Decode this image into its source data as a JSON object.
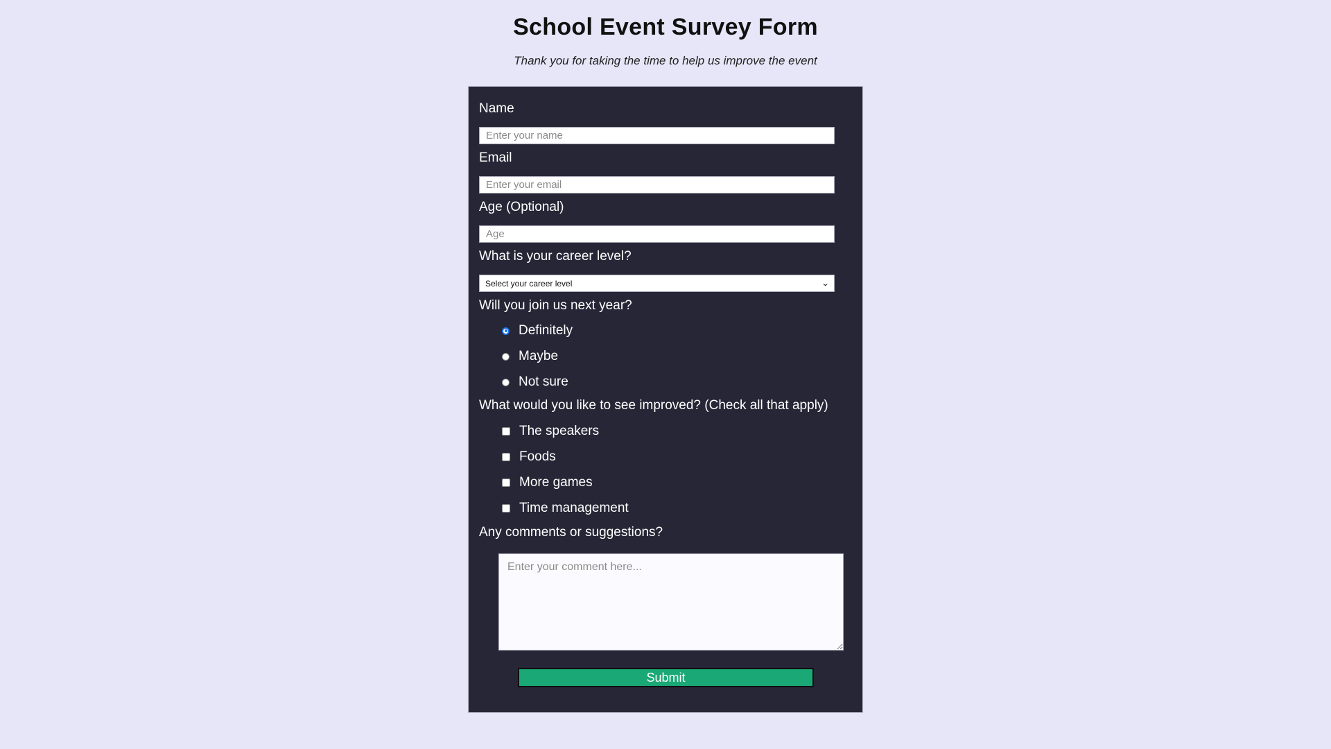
{
  "page": {
    "title": "School Event Survey Form",
    "description": "Thank you for taking the time to help us improve the event"
  },
  "form": {
    "name": {
      "label": "Name",
      "placeholder": "Enter your name",
      "value": ""
    },
    "email": {
      "label": "Email",
      "placeholder": "Enter your email",
      "value": ""
    },
    "age": {
      "label": "Age (Optional)",
      "placeholder": "Age",
      "value": ""
    },
    "career": {
      "label": "What is your career level?",
      "selected": "Select your career level",
      "caret_icon": "chevron-down-icon"
    },
    "join": {
      "label": "Will you join us next year?",
      "options": [
        {
          "label": "Definitely",
          "checked": true
        },
        {
          "label": "Maybe",
          "checked": false
        },
        {
          "label": "Not sure",
          "checked": false
        }
      ]
    },
    "improve": {
      "label": "What would you like to see improved? (Check all that apply)",
      "options": [
        {
          "label": "The speakers",
          "checked": false
        },
        {
          "label": "Foods",
          "checked": false
        },
        {
          "label": "More games",
          "checked": false
        },
        {
          "label": "Time management",
          "checked": false
        }
      ]
    },
    "comments": {
      "label": "Any comments or suggestions?",
      "placeholder": "Enter your comment here...",
      "value": ""
    },
    "submit_label": "Submit"
  },
  "colors": {
    "page_background": "#e6e6f8",
    "panel_background": "#262636",
    "submit_background": "#1aa876",
    "radio_selected": "#1a73e8"
  }
}
